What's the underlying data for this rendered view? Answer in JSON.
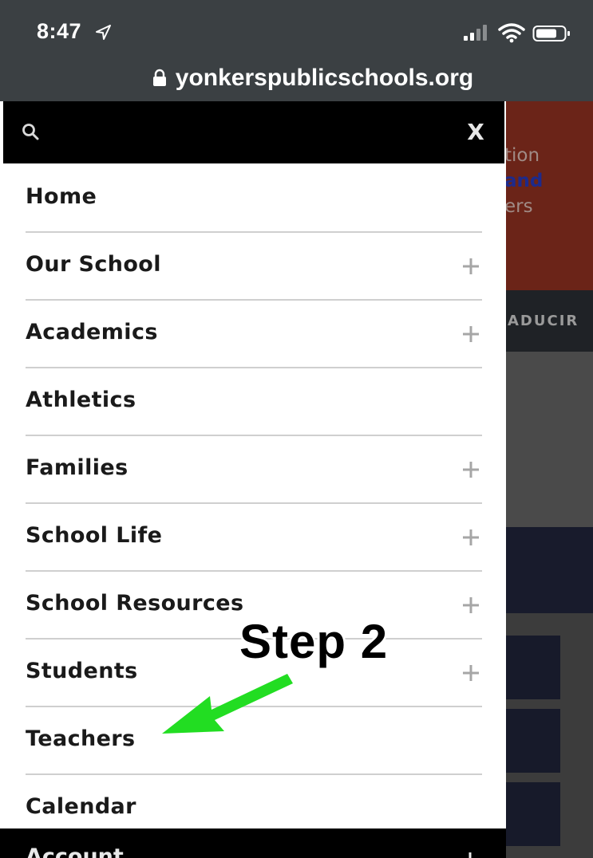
{
  "status_bar": {
    "time": "8:47"
  },
  "browser": {
    "url": "yonkerspublicschools.org"
  },
  "background_page": {
    "banner_line_1": "tion",
    "banner_line_2": "and",
    "banner_line_3": "ers",
    "translate_label": "ADUCIR"
  },
  "drawer": {
    "close_label": "X",
    "menu": [
      {
        "label": "Home",
        "expandable": false
      },
      {
        "label": "Our School",
        "expandable": true
      },
      {
        "label": "Academics",
        "expandable": true
      },
      {
        "label": "Athletics",
        "expandable": false
      },
      {
        "label": "Families",
        "expandable": true
      },
      {
        "label": "School Life",
        "expandable": true
      },
      {
        "label": "School Resources",
        "expandable": true
      },
      {
        "label": "Students",
        "expandable": true
      },
      {
        "label": "Teachers",
        "expandable": false
      },
      {
        "label": "Calendar",
        "expandable": false
      }
    ],
    "account_label": "Account"
  },
  "annotation": {
    "text": "Step 2",
    "arrow_color": "#22dd22"
  },
  "colors": {
    "status_bar_bg": "#3b4043",
    "drawer_bg": "#ffffff",
    "search_bar_bg": "#000000",
    "divider": "#cfcfcf",
    "banner_red": "#6b2418"
  }
}
